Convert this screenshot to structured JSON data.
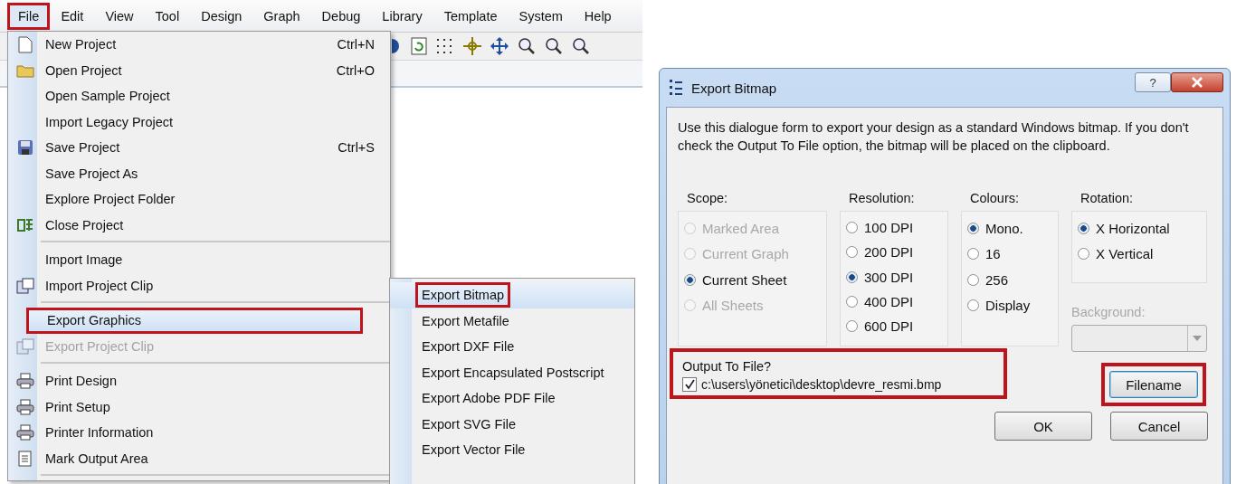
{
  "menubar": [
    {
      "label": "File",
      "selected": true,
      "highlighted": true
    },
    {
      "label": "Edit",
      "selected": false,
      "highlighted": false
    },
    {
      "label": "View",
      "selected": false,
      "highlighted": false
    },
    {
      "label": "Tool",
      "selected": false,
      "highlighted": false
    },
    {
      "label": "Design",
      "selected": false,
      "highlighted": false
    },
    {
      "label": "Graph",
      "selected": false,
      "highlighted": false
    },
    {
      "label": "Debug",
      "selected": false,
      "highlighted": false
    },
    {
      "label": "Library",
      "selected": false,
      "highlighted": false
    },
    {
      "label": "Template",
      "selected": false,
      "highlighted": false
    },
    {
      "label": "System",
      "selected": false,
      "highlighted": false
    },
    {
      "label": "Help",
      "selected": false,
      "highlighted": false
    }
  ],
  "file_menu": [
    {
      "kind": "item",
      "label": "New Project",
      "shortcut": "Ctrl+N",
      "selected": false,
      "disabled": false,
      "highlighted": false
    },
    {
      "kind": "item",
      "label": "Open Project",
      "shortcut": "Ctrl+O",
      "selected": false,
      "disabled": false,
      "highlighted": false
    },
    {
      "kind": "item",
      "label": "Open Sample Project",
      "selected": false,
      "disabled": false,
      "highlighted": false
    },
    {
      "kind": "item",
      "label": "Import Legacy Project",
      "selected": false,
      "disabled": false,
      "highlighted": false
    },
    {
      "kind": "item",
      "label": "Save Project",
      "shortcut": "Ctrl+S",
      "selected": false,
      "disabled": false,
      "highlighted": false
    },
    {
      "kind": "item",
      "label": "Save Project As",
      "selected": false,
      "disabled": false,
      "highlighted": false
    },
    {
      "kind": "item",
      "label": "Explore Project Folder",
      "selected": false,
      "disabled": false,
      "highlighted": false
    },
    {
      "kind": "item",
      "label": "Close Project",
      "selected": false,
      "disabled": false,
      "highlighted": false
    },
    {
      "kind": "separator"
    },
    {
      "kind": "item",
      "label": "Import Image",
      "selected": false,
      "disabled": false,
      "highlighted": false
    },
    {
      "kind": "item",
      "label": "Import Project Clip",
      "selected": false,
      "disabled": false,
      "highlighted": false
    },
    {
      "kind": "separator"
    },
    {
      "kind": "item",
      "label": "Export Graphics",
      "selected": true,
      "disabled": false,
      "highlighted": true
    },
    {
      "kind": "item",
      "label": "Export Project Clip",
      "selected": false,
      "disabled": true,
      "highlighted": false
    },
    {
      "kind": "separator"
    },
    {
      "kind": "item",
      "label": "Print Design",
      "selected": false,
      "disabled": false,
      "highlighted": false
    },
    {
      "kind": "item",
      "label": "Print Setup",
      "selected": false,
      "disabled": false,
      "highlighted": false
    },
    {
      "kind": "item",
      "label": "Printer Information",
      "selected": false,
      "disabled": false,
      "highlighted": false
    },
    {
      "kind": "item",
      "label": "Mark Output Area",
      "selected": false,
      "disabled": false,
      "highlighted": false
    },
    {
      "kind": "separator"
    }
  ],
  "export_submenu": [
    {
      "label": "Export Bitmap",
      "selected": true,
      "highlighted": true
    },
    {
      "label": "Export Metafile",
      "selected": false,
      "highlighted": false
    },
    {
      "label": "Export DXF File",
      "selected": false,
      "highlighted": false
    },
    {
      "label": "Export Encapsulated Postscript",
      "selected": false,
      "highlighted": false
    },
    {
      "label": "Export Adobe PDF File",
      "selected": false,
      "highlighted": false
    },
    {
      "label": "Export SVG File",
      "selected": false,
      "highlighted": false
    },
    {
      "label": "Export Vector File",
      "selected": false,
      "highlighted": false
    }
  ],
  "dialog": {
    "title": "Export Bitmap",
    "help_button": "?",
    "description": "Use this dialogue form to export your design as a standard Windows bitmap. If you don't check the Output To File option, the bitmap will be placed on the clipboard.",
    "groups": [
      {
        "title": "Scope:",
        "options": [
          {
            "label": "Marked Area",
            "selected": false,
            "disabled": true
          },
          {
            "label": "Current Graph",
            "selected": false,
            "disabled": true
          },
          {
            "label": "Current Sheet",
            "selected": true,
            "disabled": false
          },
          {
            "label": "All Sheets",
            "selected": false,
            "disabled": true
          }
        ]
      },
      {
        "title": "Resolution:",
        "options": [
          {
            "label": "100 DPI",
            "selected": false,
            "disabled": false
          },
          {
            "label": "200 DPI",
            "selected": false,
            "disabled": false
          },
          {
            "label": "300 DPI",
            "selected": true,
            "disabled": false
          },
          {
            "label": "400 DPI",
            "selected": false,
            "disabled": false
          },
          {
            "label": "600 DPI",
            "selected": false,
            "disabled": false
          }
        ]
      },
      {
        "title": "Colours:",
        "options": [
          {
            "label": "Mono.",
            "selected": true,
            "disabled": false
          },
          {
            "label": "16",
            "selected": false,
            "disabled": false
          },
          {
            "label": "256",
            "selected": false,
            "disabled": false
          },
          {
            "label": "Display",
            "selected": false,
            "disabled": false
          }
        ]
      },
      {
        "title": "Rotation:",
        "options": [
          {
            "label": "X Horizontal",
            "selected": true,
            "disabled": false
          },
          {
            "label": "X Vertical",
            "selected": false,
            "disabled": false
          }
        ]
      }
    ],
    "background": {
      "label": "Background:",
      "disabled": true
    },
    "output": {
      "title": "Output To File?",
      "checked": true,
      "path": "c:\\users\\yönetici\\desktop\\devre_resmi.bmp",
      "highlighted": true
    },
    "filename_button": {
      "label": "Filename",
      "highlighted": true
    },
    "buttons": [
      {
        "label": "OK"
      },
      {
        "label": "Cancel"
      }
    ]
  }
}
